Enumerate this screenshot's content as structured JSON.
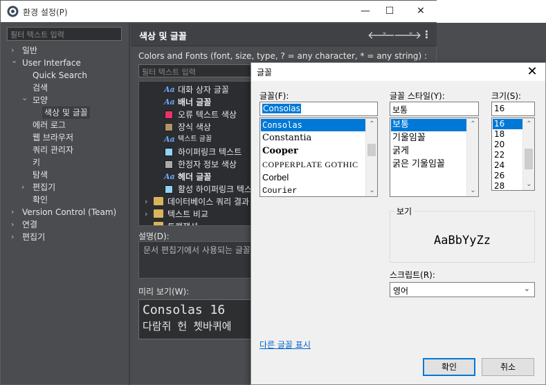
{
  "preferences": {
    "title": "환경 설정(P)",
    "filter_placeholder": "필터 텍스트 입력",
    "tree": [
      {
        "label": "일반",
        "arrow": "›"
      },
      {
        "label": "User Interface",
        "arrow": "⌄"
      },
      {
        "label": "Quick Search",
        "arrow": ""
      },
      {
        "label": "검색",
        "arrow": ""
      },
      {
        "label": "모양",
        "arrow": "⌄"
      },
      {
        "label": "색상 및 글꼴",
        "arrow": ""
      },
      {
        "label": "에러 로그",
        "arrow": ""
      },
      {
        "label": "웹 브라우저",
        "arrow": ""
      },
      {
        "label": "쿼리 관리자",
        "arrow": ""
      },
      {
        "label": "키",
        "arrow": ""
      },
      {
        "label": "탐색",
        "arrow": ""
      },
      {
        "label": "편집기",
        "arrow": "›"
      },
      {
        "label": "확인",
        "arrow": ""
      },
      {
        "label": "Version Control (Team)",
        "arrow": "›"
      },
      {
        "label": "연결",
        "arrow": "›"
      },
      {
        "label": "편집기",
        "arrow": "›"
      }
    ],
    "page_title": "색상 및 글꼴",
    "nav": {
      "back": "🡐",
      "forward": "🡒",
      "menu": "⋮",
      "dropdown": "▾"
    },
    "colors_desc": "Colors and Fonts (font, size, type, ? = any character, * = any string) :",
    "colors_filter_placeholder": "필터 텍스트 입력",
    "color_items": [
      {
        "type": "font",
        "label": "대화 상자 글꼴"
      },
      {
        "type": "font",
        "label": "배너 글꼴"
      },
      {
        "type": "color",
        "label": "오류 텍스트 색상",
        "color": "#e8336d"
      },
      {
        "type": "color",
        "label": "장식 색상",
        "color": "#b09468"
      },
      {
        "type": "font",
        "label": "텍스트 글꼴"
      },
      {
        "type": "color",
        "label": "하이퍼링크 텍스트",
        "color": "#8fd3f5"
      },
      {
        "type": "color",
        "label": "한정자 정보 색상",
        "color": "#aaaaaa"
      },
      {
        "type": "font",
        "label": "헤더 글꼴"
      },
      {
        "type": "color",
        "label": "활성 하이퍼링크 텍스트",
        "color": "#8fd3f5"
      },
      {
        "type": "folder",
        "label": "데이터베이스 쿼리 결과"
      },
      {
        "type": "folder",
        "label": "텍스트 비교"
      },
      {
        "type": "folder",
        "label": "트랜잭션"
      }
    ],
    "description_label": "설명(D):",
    "description_text": "문서 편집기에서 사용되는 글꼴",
    "preview_label": "미리 보기(W):",
    "preview_line1": "Consolas 16",
    "preview_line2": "다람쥐 헌 쳇바퀴에"
  },
  "dialog": {
    "title": "글꼴",
    "close": "✕",
    "font_label": "글꼴(F):",
    "font_value": "Consolas",
    "fonts": [
      "Consolas",
      "Constantia",
      "Cooper",
      "COPPERPLATE GOTHIC",
      "Corbel",
      "Courier"
    ],
    "style_label": "글꼴 스타일(Y):",
    "style_value": "보통",
    "styles": [
      "보통",
      "기울임꼴",
      "굵게",
      "굵은 기울임꼴"
    ],
    "size_label": "크기(S):",
    "size_value": "16",
    "sizes": [
      "16",
      "18",
      "20",
      "22",
      "24",
      "26",
      "28"
    ],
    "sample_label": "보기",
    "sample_text": "AaBbYyZz",
    "script_label": "스크립트(R):",
    "script_value": "영어",
    "more_fonts_link": "다른 글꼴 표시",
    "ok_label": "확인",
    "cancel_label": "취소"
  }
}
